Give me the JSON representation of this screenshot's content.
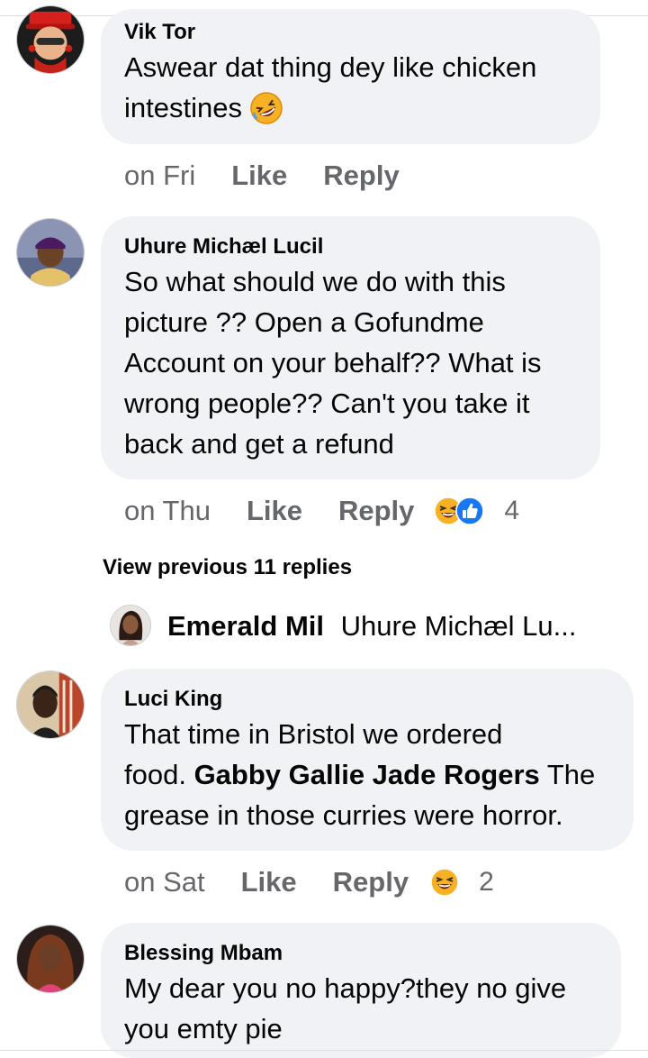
{
  "comments": [
    {
      "author": "Vik Tor",
      "text_lines": [
        "Aswear dat thing dey like chicken",
        "intestines"
      ],
      "emoji": "rolling-laughing",
      "time": "on Fri",
      "like_label": "Like",
      "reply_label": "Reply"
    },
    {
      "author": "Uhure Michæl Lucil",
      "text_lines": [
        "So what should we do with this",
        "picture ?? Open a Gofundme",
        "Account on your behalf?? What is",
        "wrong people?? Can't you take it",
        "back and get a refund"
      ],
      "time": "on Thu",
      "like_label": "Like",
      "reply_label": "Reply",
      "reactions": [
        "haha",
        "like"
      ],
      "reaction_count": "4"
    },
    {
      "author": "Luci King",
      "line1": "That time in Bristol we ordered",
      "line2_prefix": "food. ",
      "line2_tag": "Gabby Gallie Jade Rogers",
      "line2_suffix": " The",
      "line3": "grease in those curries were horror.",
      "time": "on Sat",
      "like_label": "Like",
      "reply_label": "Reply",
      "reactions": [
        "haha"
      ],
      "reaction_count": "2"
    },
    {
      "author": "Blessing Mbam",
      "text_lines": [
        "My dear you no happy?they no give",
        "you emty pie"
      ]
    }
  ],
  "view_previous": "View previous 11 replies",
  "reply_preview": {
    "name": "Emerald Mil",
    "text": "Uhure Michæl Lu..."
  },
  "colors": {
    "bubble": "#f0f2f5",
    "meta_gray": "#65676b",
    "text": "#050505",
    "like_blue": "#1877f2",
    "haha_yellow": "#f7b125"
  }
}
